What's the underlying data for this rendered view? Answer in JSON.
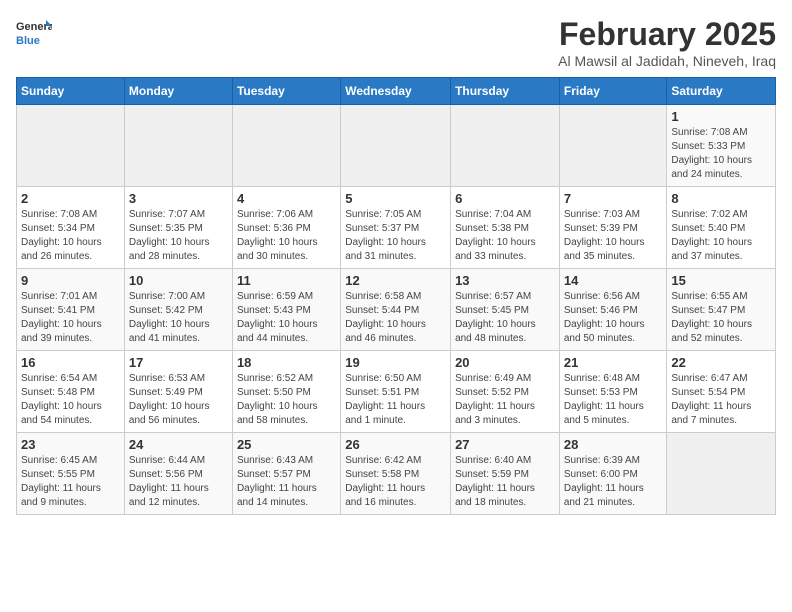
{
  "header": {
    "logo_line1": "General",
    "logo_line2": "Blue",
    "month": "February 2025",
    "location": "Al Mawsil al Jadidah, Nineveh, Iraq"
  },
  "days_of_week": [
    "Sunday",
    "Monday",
    "Tuesday",
    "Wednesday",
    "Thursday",
    "Friday",
    "Saturday"
  ],
  "weeks": [
    [
      {
        "day": "",
        "detail": ""
      },
      {
        "day": "",
        "detail": ""
      },
      {
        "day": "",
        "detail": ""
      },
      {
        "day": "",
        "detail": ""
      },
      {
        "day": "",
        "detail": ""
      },
      {
        "day": "",
        "detail": ""
      },
      {
        "day": "1",
        "detail": "Sunrise: 7:08 AM\nSunset: 5:33 PM\nDaylight: 10 hours\nand 24 minutes."
      }
    ],
    [
      {
        "day": "2",
        "detail": "Sunrise: 7:08 AM\nSunset: 5:34 PM\nDaylight: 10 hours\nand 26 minutes."
      },
      {
        "day": "3",
        "detail": "Sunrise: 7:07 AM\nSunset: 5:35 PM\nDaylight: 10 hours\nand 28 minutes."
      },
      {
        "day": "4",
        "detail": "Sunrise: 7:06 AM\nSunset: 5:36 PM\nDaylight: 10 hours\nand 30 minutes."
      },
      {
        "day": "5",
        "detail": "Sunrise: 7:05 AM\nSunset: 5:37 PM\nDaylight: 10 hours\nand 31 minutes."
      },
      {
        "day": "6",
        "detail": "Sunrise: 7:04 AM\nSunset: 5:38 PM\nDaylight: 10 hours\nand 33 minutes."
      },
      {
        "day": "7",
        "detail": "Sunrise: 7:03 AM\nSunset: 5:39 PM\nDaylight: 10 hours\nand 35 minutes."
      },
      {
        "day": "8",
        "detail": "Sunrise: 7:02 AM\nSunset: 5:40 PM\nDaylight: 10 hours\nand 37 minutes."
      }
    ],
    [
      {
        "day": "9",
        "detail": "Sunrise: 7:01 AM\nSunset: 5:41 PM\nDaylight: 10 hours\nand 39 minutes."
      },
      {
        "day": "10",
        "detail": "Sunrise: 7:00 AM\nSunset: 5:42 PM\nDaylight: 10 hours\nand 41 minutes."
      },
      {
        "day": "11",
        "detail": "Sunrise: 6:59 AM\nSunset: 5:43 PM\nDaylight: 10 hours\nand 44 minutes."
      },
      {
        "day": "12",
        "detail": "Sunrise: 6:58 AM\nSunset: 5:44 PM\nDaylight: 10 hours\nand 46 minutes."
      },
      {
        "day": "13",
        "detail": "Sunrise: 6:57 AM\nSunset: 5:45 PM\nDaylight: 10 hours\nand 48 minutes."
      },
      {
        "day": "14",
        "detail": "Sunrise: 6:56 AM\nSunset: 5:46 PM\nDaylight: 10 hours\nand 50 minutes."
      },
      {
        "day": "15",
        "detail": "Sunrise: 6:55 AM\nSunset: 5:47 PM\nDaylight: 10 hours\nand 52 minutes."
      }
    ],
    [
      {
        "day": "16",
        "detail": "Sunrise: 6:54 AM\nSunset: 5:48 PM\nDaylight: 10 hours\nand 54 minutes."
      },
      {
        "day": "17",
        "detail": "Sunrise: 6:53 AM\nSunset: 5:49 PM\nDaylight: 10 hours\nand 56 minutes."
      },
      {
        "day": "18",
        "detail": "Sunrise: 6:52 AM\nSunset: 5:50 PM\nDaylight: 10 hours\nand 58 minutes."
      },
      {
        "day": "19",
        "detail": "Sunrise: 6:50 AM\nSunset: 5:51 PM\nDaylight: 11 hours\nand 1 minute."
      },
      {
        "day": "20",
        "detail": "Sunrise: 6:49 AM\nSunset: 5:52 PM\nDaylight: 11 hours\nand 3 minutes."
      },
      {
        "day": "21",
        "detail": "Sunrise: 6:48 AM\nSunset: 5:53 PM\nDaylight: 11 hours\nand 5 minutes."
      },
      {
        "day": "22",
        "detail": "Sunrise: 6:47 AM\nSunset: 5:54 PM\nDaylight: 11 hours\nand 7 minutes."
      }
    ],
    [
      {
        "day": "23",
        "detail": "Sunrise: 6:45 AM\nSunset: 5:55 PM\nDaylight: 11 hours\nand 9 minutes."
      },
      {
        "day": "24",
        "detail": "Sunrise: 6:44 AM\nSunset: 5:56 PM\nDaylight: 11 hours\nand 12 minutes."
      },
      {
        "day": "25",
        "detail": "Sunrise: 6:43 AM\nSunset: 5:57 PM\nDaylight: 11 hours\nand 14 minutes."
      },
      {
        "day": "26",
        "detail": "Sunrise: 6:42 AM\nSunset: 5:58 PM\nDaylight: 11 hours\nand 16 minutes."
      },
      {
        "day": "27",
        "detail": "Sunrise: 6:40 AM\nSunset: 5:59 PM\nDaylight: 11 hours\nand 18 minutes."
      },
      {
        "day": "28",
        "detail": "Sunrise: 6:39 AM\nSunset: 6:00 PM\nDaylight: 11 hours\nand 21 minutes."
      },
      {
        "day": "",
        "detail": ""
      }
    ]
  ]
}
